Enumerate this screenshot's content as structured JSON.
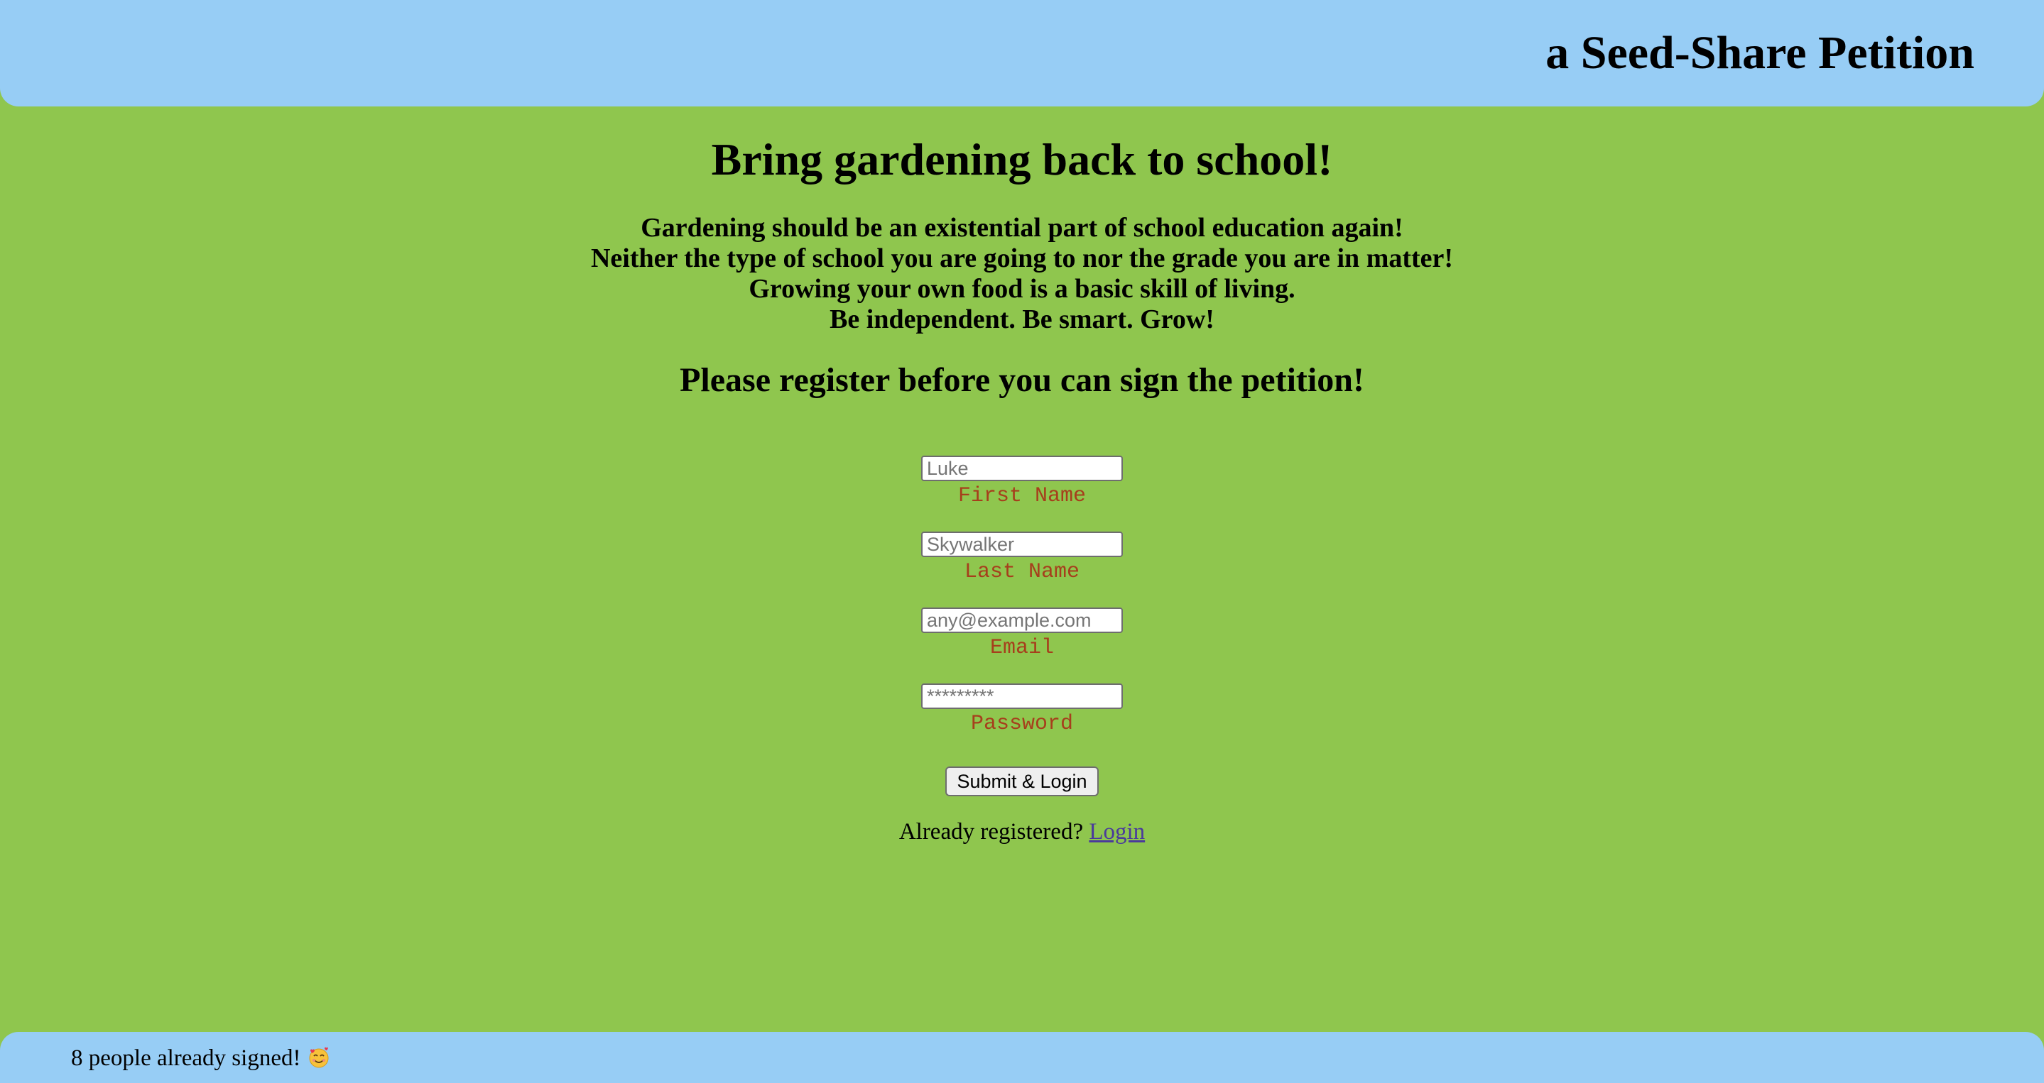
{
  "header": {
    "title": "a Seed-Share Petition"
  },
  "main": {
    "headline": "Bring gardening back to school!",
    "pitch_lines": [
      "Gardening should be an existential part of school education again!",
      "Neither the type of school you are going to nor the grade you are in matter!",
      "Growing your own food is a basic skill of living.",
      "Be independent. Be smart. Grow!"
    ],
    "register_heading": "Please register before you can sign the petition!"
  },
  "form": {
    "first_name": {
      "placeholder": "Luke",
      "value": "",
      "label": "First Name"
    },
    "last_name": {
      "placeholder": "Skywalker",
      "value": "",
      "label": "Last Name"
    },
    "email": {
      "placeholder": "any@example.com",
      "value": "",
      "label": "Email"
    },
    "password": {
      "placeholder": "*********",
      "value": "",
      "label": "Password"
    },
    "submit_label": "Submit & Login",
    "already_text": "Already registered?",
    "login_link": "Login"
  },
  "footer": {
    "signed_text": "8 people already signed!",
    "emoji_icon": "smiling-face-with-hearts-icon"
  },
  "colors": {
    "page_background": "#8fc64e",
    "banner_background": "#97cdf5",
    "field_label": "#a63f1c",
    "link": "#4a3a9c"
  }
}
